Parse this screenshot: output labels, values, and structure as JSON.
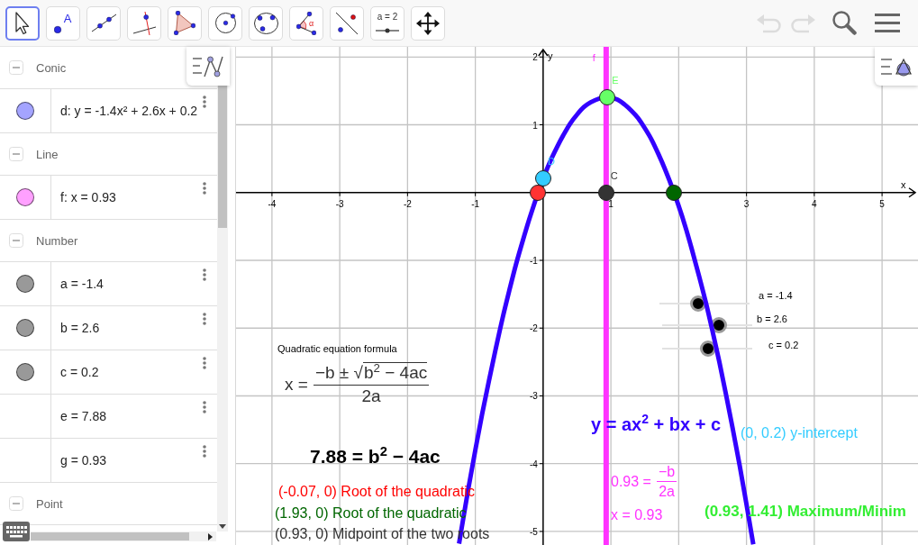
{
  "toolbar": {
    "tools": [
      {
        "kind": "move",
        "selected": true
      },
      {
        "kind": "point",
        "text": "A",
        "selected": false
      },
      {
        "kind": "line",
        "selected": false
      },
      {
        "kind": "perpendicular",
        "selected": false
      },
      {
        "kind": "polygon",
        "selected": false
      },
      {
        "kind": "circle",
        "selected": false
      },
      {
        "kind": "conic",
        "selected": false
      },
      {
        "kind": "angle",
        "text": "α",
        "selected": false
      },
      {
        "kind": "reflect",
        "selected": false
      },
      {
        "kind": "slider",
        "text": "a = 2",
        "selected": false
      },
      {
        "kind": "move-view",
        "selected": false
      }
    ],
    "actions": [
      {
        "kind": "undo",
        "disabled": true
      },
      {
        "kind": "redo",
        "disabled": true
      },
      {
        "kind": "search",
        "disabled": false
      },
      {
        "kind": "menu",
        "disabled": false
      }
    ]
  },
  "algebra": {
    "groups": [
      {
        "label": "Conic",
        "expanded": true,
        "items": [
          {
            "text": "d: y = -1.4x² + 2.6x + 0.2",
            "color": "#a4a4ff"
          }
        ]
      },
      {
        "label": "Line",
        "expanded": true,
        "items": [
          {
            "text": "f: x = 0.93",
            "color": "#ffa0ff"
          }
        ]
      },
      {
        "label": "Number",
        "expanded": true,
        "items": [
          {
            "text": "a = -1.4",
            "color": "#999999"
          },
          {
            "text": "b = 2.6",
            "color": "#999999"
          },
          {
            "text": "c = 0.2",
            "color": "#999999"
          },
          {
            "text": "e = 7.88"
          },
          {
            "text": "g = 0.93"
          }
        ]
      },
      {
        "label": "Point",
        "expanded": true
      }
    ]
  },
  "graphics": {
    "chart_data": {
      "type": "line",
      "xlabel": "x",
      "ylabel": "y",
      "grid": true,
      "x": [
        -1.24,
        -1.2,
        -1.1,
        -1,
        -0.9,
        -0.8,
        -0.7,
        -0.6,
        -0.5,
        -0.4,
        -0.3,
        -0.2,
        0.1,
        0.2,
        0.3,
        0.4,
        0.5,
        0.6,
        0.7,
        1.15,
        1.2,
        1.3,
        1.4,
        1.5,
        1.6,
        1.7,
        1.8,
        2.05,
        2.1,
        2.2,
        2.3,
        2.4,
        2.5,
        2.6,
        2.7,
        2.8,
        2.9,
        3,
        3.1
      ],
      "series": [
        {
          "color": "#3300ff",
          "values": [
            -5.18,
            -4.94,
            -4.35,
            -3.8,
            -3.27,
            -2.78,
            -2.31,
            -1.86,
            -1.45,
            -1.06,
            -0.71,
            -0.38,
            0.45,
            0.66,
            0.85,
            1.02,
            1.15,
            1.26,
            1.33,
            1.34,
            1.3,
            1.21,
            1.1,
            0.95,
            0.78,
            0.57,
            0.34,
            -0.35,
            -0.51,
            -0.86,
            -1.23,
            -1.62,
            -2.05,
            -2.5,
            -2.99,
            -3.5,
            -4.03,
            -4.6,
            -5.19
          ]
        }
      ],
      "xlim": [
        -4.53,
        5.53
      ],
      "ylim": [
        -5.2,
        2.15
      ],
      "xticks": [
        -4,
        -3,
        -2,
        -1,
        1,
        3,
        4,
        5
      ],
      "yticks": [
        -5,
        -4,
        -3,
        -2,
        -1,
        1,
        2
      ],
      "ref_lines": [
        {
          "axis": "x",
          "value": 0.93,
          "label": "f",
          "color": "#ff33ff"
        }
      ]
    },
    "points": [
      {
        "kind": "vertex",
        "label": "E",
        "color": "#66ff66"
      },
      {
        "kind": "y-intercept",
        "label": "D",
        "color": "#33ccff"
      },
      {
        "kind": "root",
        "color": "#ff3333"
      },
      {
        "kind": "midpoint",
        "label": "C",
        "color": "#333333"
      },
      {
        "kind": "root",
        "color": "#006600"
      }
    ],
    "sliders": [
      {
        "label": "a = -1.4",
        "level": 0.43
      },
      {
        "label": "b = 2.6",
        "level": 0.63
      },
      {
        "label": "c = 0.2",
        "level": 0.51
      }
    ],
    "texts": [
      {
        "kind": "caption",
        "text": "Quadratic equation formula",
        "color": "#000000"
      },
      {
        "kind": "radical-fraction",
        "lhs": "x =",
        "numerator": "−b ±",
        "radical": "√",
        "radicand": "b$^{2}$ − 4ac",
        "denominator": "2a",
        "color": "#333333"
      },
      {
        "kind": "formula",
        "text": "7.88 = b$^{2}$ − 4ac",
        "color": "#000000"
      },
      {
        "kind": "plain",
        "text": "(-0.07, 0) Root of the quadratic",
        "color": "#ff0000"
      },
      {
        "kind": "plain",
        "text": "(1.93, 0) Root of the quadratic",
        "color": "#006600"
      },
      {
        "kind": "plain",
        "text": "(0.93, 0) Midpoint of the two roots",
        "color": "#333333"
      },
      {
        "kind": "formula",
        "text": "y = ax$^{2}$ + bx + c",
        "color": "#3300ff"
      },
      {
        "kind": "plain",
        "text": "(0, 0.2) y-intercept",
        "color": "#33ccff"
      },
      {
        "kind": "fraction",
        "lhs": "0.93 =",
        "numerator": "−b",
        "denominator": "2a",
        "color": "#ff33ff"
      },
      {
        "kind": "plain",
        "text": "x = 0.93",
        "color": "#ff33ff"
      },
      {
        "kind": "bold",
        "text": "(0.93, 1.41) Maximum/Minim",
        "color": "#33ee33"
      }
    ]
  }
}
